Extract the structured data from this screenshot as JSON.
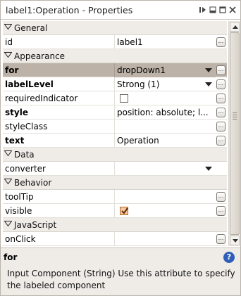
{
  "window": {
    "title": "label1:Operation - Properties"
  },
  "titlebar_icons": [
    "panel-menu-icon",
    "minimize-icon",
    "maximize-icon",
    "close-icon"
  ],
  "ellipsis_label": "...",
  "rows": [
    {
      "kind": "category",
      "label": "General"
    },
    {
      "kind": "prop",
      "name": "id",
      "bold": false,
      "value": "label1",
      "editor": "text",
      "button": true
    },
    {
      "kind": "category",
      "label": "Appearance"
    },
    {
      "kind": "prop",
      "name": "for",
      "bold": true,
      "value": "dropDown1",
      "editor": "dropdown",
      "button": true,
      "selected": true
    },
    {
      "kind": "prop",
      "name": "labelLevel",
      "bold": true,
      "value": "Strong (1)",
      "editor": "dropdown",
      "button": true
    },
    {
      "kind": "prop",
      "name": "requiredIndicator",
      "bold": false,
      "value": "",
      "editor": "checkbox",
      "checked": false,
      "button": true
    },
    {
      "kind": "prop",
      "name": "style",
      "bold": true,
      "value": "position: absolute; l...",
      "editor": "text",
      "button": true
    },
    {
      "kind": "prop",
      "name": "styleClass",
      "bold": false,
      "value": "",
      "editor": "text",
      "button": true
    },
    {
      "kind": "prop",
      "name": "text",
      "bold": true,
      "value": "Operation",
      "editor": "text",
      "button": true
    },
    {
      "kind": "category",
      "label": "Data"
    },
    {
      "kind": "prop",
      "name": "converter",
      "bold": false,
      "value": "",
      "editor": "dropdown",
      "button": false
    },
    {
      "kind": "category",
      "label": "Behavior"
    },
    {
      "kind": "prop",
      "name": "toolTip",
      "bold": false,
      "value": "",
      "editor": "text",
      "button": true
    },
    {
      "kind": "prop",
      "name": "visible",
      "bold": false,
      "value": "",
      "editor": "checkbox",
      "checked": true,
      "button": true
    },
    {
      "kind": "category",
      "label": "JavaScript"
    },
    {
      "kind": "prop",
      "name": "onClick",
      "bold": false,
      "value": "",
      "editor": "text",
      "button": true
    }
  ],
  "help": {
    "title": "for",
    "description": "Input Component (String) Use this attribute to specify the labeled component",
    "icon_label": "?"
  },
  "colors": {
    "selected_row": "#bcb2a7",
    "category_bg": "#efece8",
    "help_icon": "#2f5fb8",
    "checkbox_checked": "#f6c9a2"
  }
}
